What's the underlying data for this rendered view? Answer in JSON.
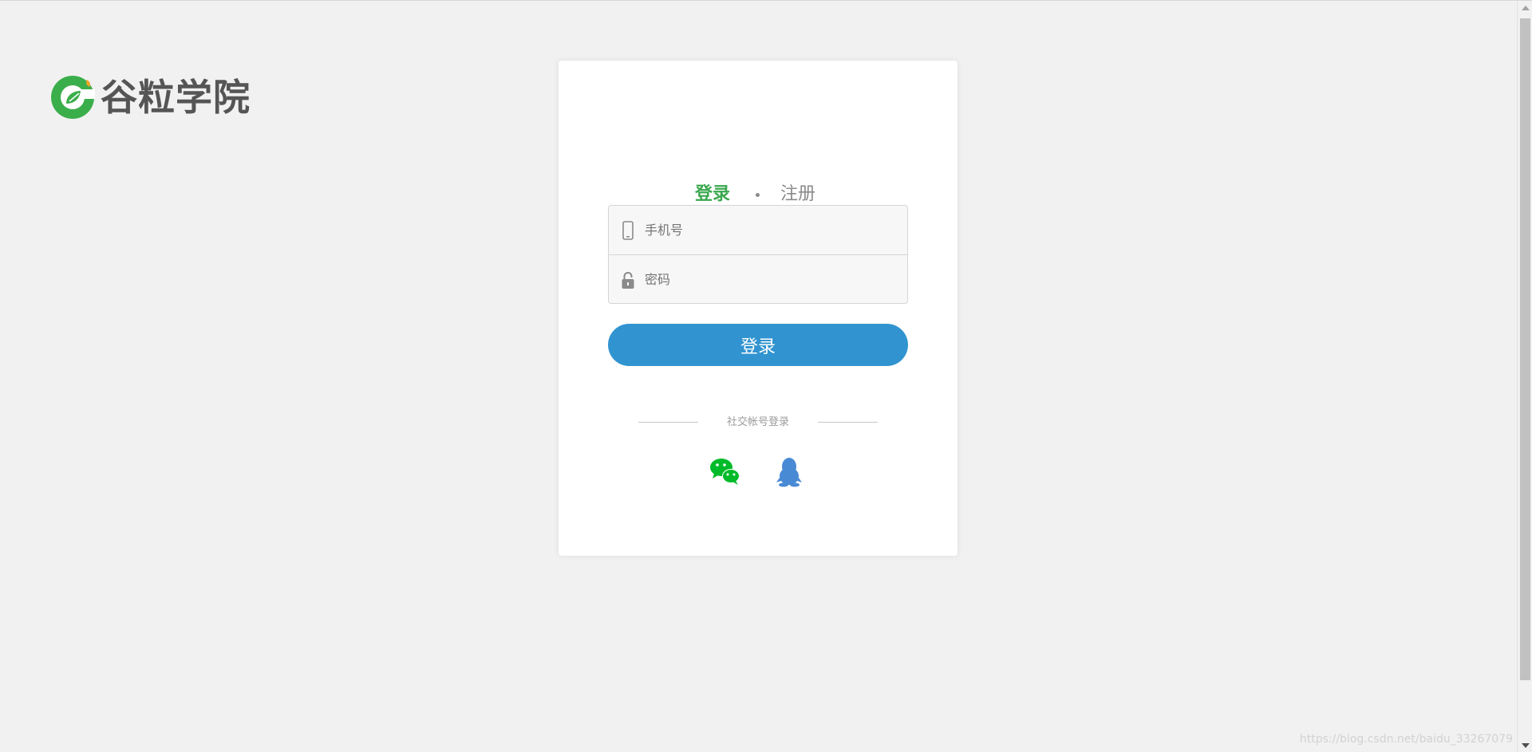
{
  "logo": {
    "text": "谷粒学院",
    "icon": "guli-logo-icon",
    "colors": {
      "green": "#3aae4a",
      "leaf": "#f0a52a",
      "text": "#555555"
    }
  },
  "tabs": [
    {
      "label": "登录",
      "active": true
    },
    {
      "label": "注册",
      "active": false
    }
  ],
  "form": {
    "phone": {
      "placeholder": "手机号",
      "value": "",
      "icon": "mobile-phone-icon"
    },
    "password": {
      "placeholder": "密码",
      "value": "",
      "icon": "lock-icon"
    },
    "submit_label": "登录"
  },
  "social": {
    "title": "社交帐号登录",
    "providers": [
      {
        "name": "wechat",
        "icon": "wechat-icon",
        "color": "#00bb29"
      },
      {
        "name": "qq",
        "icon": "qq-icon",
        "color": "#498ad5"
      }
    ]
  },
  "watermark": "https://blog.csdn.net/baidu_33267079",
  "colors": {
    "accent_green": "#3aa84e",
    "button_blue": "#3194d0",
    "page_bg": "#f1f1f1"
  }
}
